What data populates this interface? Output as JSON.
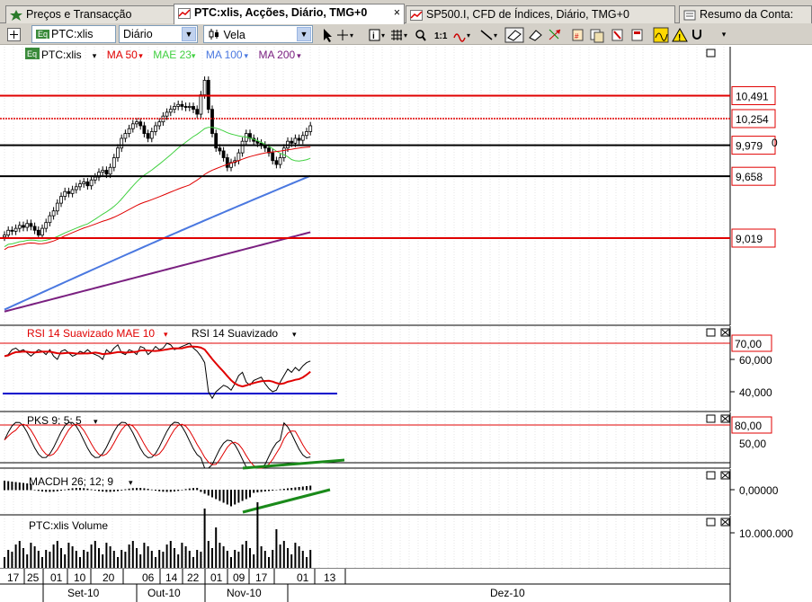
{
  "tabs": [
    {
      "label": "Preços e Transacção",
      "icon": "star-icon",
      "active": false
    },
    {
      "label": "PTC:xlis, Acções, Diário, TMG+0",
      "icon": "chart-icon",
      "active": true,
      "close": "×"
    },
    {
      "label": "SP500.I, CFD de Índices, Diário, TMG+0",
      "icon": "chart-icon",
      "active": false
    },
    {
      "label": "Resumo da Conta:",
      "icon": "account-icon",
      "active": false
    }
  ],
  "toolbar": {
    "symbol": "PTC:xlis",
    "symbol_badge": "Eq",
    "period": "Diário",
    "chart_type": "Vela",
    "tools": [
      "cursor-icon",
      "crosshair-icon",
      "info-icon",
      "grid-icon",
      "zoom-icon",
      "one-to-one-icon",
      "wave-icon",
      "line-icon",
      "eraser-icon",
      "pattern-icon",
      "arrows-icon",
      "objects-icon",
      "copy-icon",
      "alert-icon",
      "magnet-icon"
    ],
    "one_to_one_label": "1:1"
  },
  "price_panel": {
    "legend": [
      {
        "label": "PTC:xlis",
        "color": "#000000",
        "badge": "Eq"
      },
      {
        "label": "MA 50",
        "color": "#e00000"
      },
      {
        "label": "MAE 23",
        "color": "#40d040"
      },
      {
        "label": "MA 100",
        "color": "#4a78e0"
      },
      {
        "label": "MA 200",
        "color": "#7a2080"
      }
    ],
    "levels": [
      {
        "label": "10,491",
        "value": 10.491,
        "color": "#e00000"
      },
      {
        "label": "10,254",
        "value": 10.254,
        "color": "#e00000"
      },
      {
        "label": "9,979",
        "value": 9.979,
        "color": "#000000"
      },
      {
        "label": "9,658",
        "value": 9.658,
        "color": "#000000"
      },
      {
        "label": "9,019",
        "value": 9.019,
        "color": "#e00000"
      }
    ],
    "extra_axis_label": "0"
  },
  "rsi_panel": {
    "legend": [
      {
        "label": "RSI 14 Suavizado MAE 10",
        "color": "#e00000"
      },
      {
        "label": "RSI 14 Suavizado",
        "color": "#000000"
      }
    ],
    "levels": [
      {
        "label": "70,00",
        "value": 70
      },
      {
        "label": "60,000",
        "value": 60
      },
      {
        "label": "40,000",
        "value": 40
      }
    ]
  },
  "pks_panel": {
    "legend": "PKS 9; 5; 5",
    "levels": [
      {
        "label": "80,00",
        "value": 80
      },
      {
        "label": "50,00",
        "value": 50
      }
    ]
  },
  "macd_panel": {
    "legend": "MACDH 26; 12; 9",
    "levels": [
      {
        "label": "0,00000",
        "value": 0
      }
    ]
  },
  "volume_panel": {
    "legend": "PTC:xlis Volume",
    "levels": [
      {
        "label": "10.000.000",
        "value": 10000000
      }
    ]
  },
  "date_axis": {
    "days": [
      "17",
      "25",
      "01",
      "10",
      "20",
      "06",
      "14",
      "22",
      "01",
      "09",
      "17",
      "01",
      "13"
    ],
    "months": [
      "Set-10",
      "Out-10",
      "Nov-10",
      "Dez-10"
    ]
  },
  "colors": {
    "red": "#e00000",
    "green": "#20a020",
    "blue": "#0000cc",
    "darkgreen": "#1a8a1a"
  }
}
